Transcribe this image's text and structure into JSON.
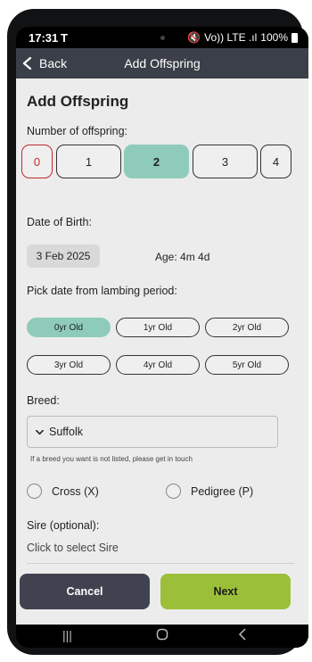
{
  "status_bar": {
    "time": "17:31",
    "carrier": "T",
    "signal_text": "Vo)) LTE .ıl",
    "battery": "100%"
  },
  "header": {
    "back_label": "Back",
    "title": "Add Offspring"
  },
  "form": {
    "page_title": "Add Offspring",
    "num_offspring_label": "Number of offspring:",
    "offspring_options": [
      "0",
      "1",
      "2",
      "3",
      "4"
    ],
    "selected_offspring": "2",
    "dob_label": "Date of Birth:",
    "dob_value": "3 Feb 2025",
    "age_text": "Age: 4m 4d",
    "lambing_label": "Pick date from lambing period:",
    "age_options": [
      "0yr Old",
      "1yr Old",
      "2yr Old",
      "3yr Old",
      "4yr Old",
      "5yr Old"
    ],
    "selected_age": "0yr Old",
    "breed_label": "Breed:",
    "breed_value": "Suffolk",
    "breed_hint": "If a breed you want is not listed, please get in touch",
    "cross_label": "Cross (X)",
    "pedigree_label": "Pedigree (P)",
    "sire_label": "Sire (optional):",
    "sire_placeholder": "Click to select Sire"
  },
  "actions": {
    "cancel_label": "Cancel",
    "next_label": "Next"
  },
  "colors": {
    "header_bg": "#3b3f49",
    "selected_bg": "#8fcbbb",
    "next_bg": "#9cbf3a",
    "cancel_bg": "#40434f",
    "zero_border": "#c0282d"
  },
  "icons": {
    "back": "chevron-left-icon",
    "breed_dropdown": "chevron-down-icon",
    "nav_recents": "recents-icon",
    "nav_home": "home-icon",
    "nav_back": "nav-back-icon"
  }
}
